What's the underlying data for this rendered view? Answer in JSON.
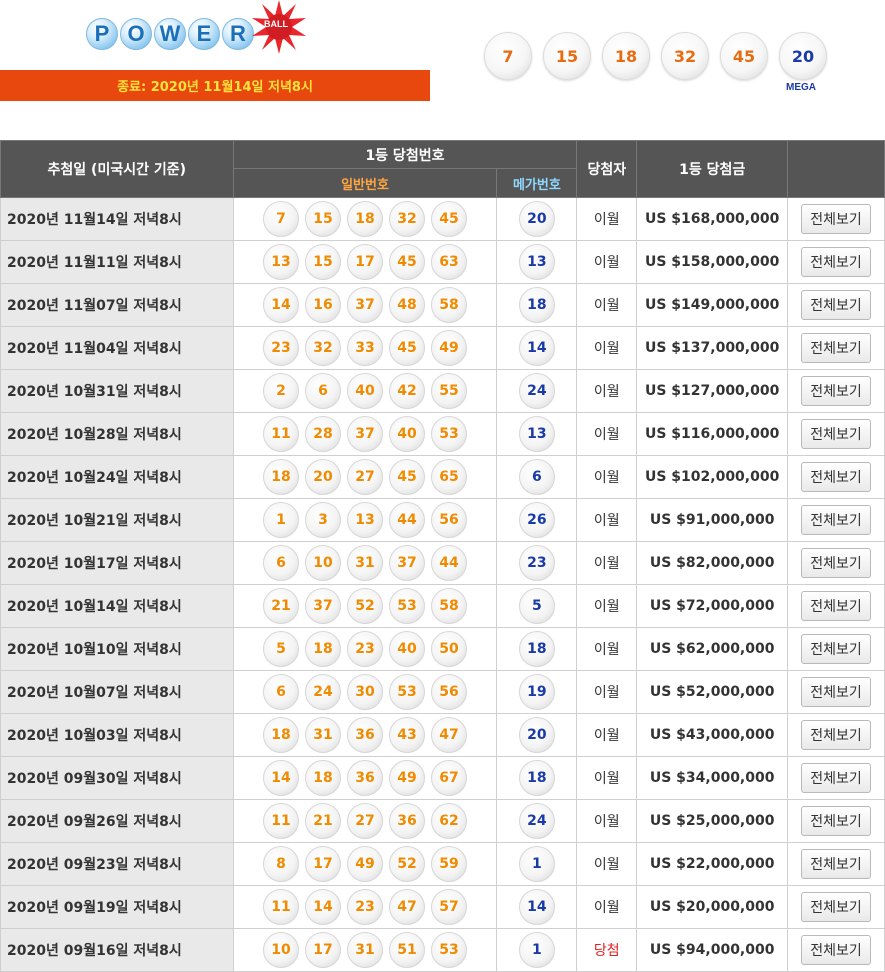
{
  "logo": {
    "letters": [
      "P",
      "O",
      "W",
      "E",
      "R"
    ],
    "ball_text": "BALL"
  },
  "closing": "종료: 2020년 11월14일 저녁8시",
  "latest": {
    "normal": [
      "7",
      "15",
      "18",
      "32",
      "45"
    ],
    "mega": "20",
    "mega_tag": "MEGA"
  },
  "headers": {
    "date": "추첨일 (미국시간 기준)",
    "first_numbers": "1등 당첨번호",
    "normal": "일반번호",
    "mega": "메가번호",
    "winner": "당첨자",
    "prize": "1등 당첨금"
  },
  "rows": [
    {
      "date": "2020년 11월14일 저녁8시",
      "n": [
        "7",
        "15",
        "18",
        "32",
        "45"
      ],
      "mega": "20",
      "winner": "이월",
      "prize": "US $168,000,000",
      "button": "전체보기"
    },
    {
      "date": "2020년 11월11일 저녁8시",
      "n": [
        "13",
        "15",
        "17",
        "45",
        "63"
      ],
      "mega": "13",
      "winner": "이월",
      "prize": "US $158,000,000",
      "button": "전체보기"
    },
    {
      "date": "2020년 11월07일 저녁8시",
      "n": [
        "14",
        "16",
        "37",
        "48",
        "58"
      ],
      "mega": "18",
      "winner": "이월",
      "prize": "US $149,000,000",
      "button": "전체보기"
    },
    {
      "date": "2020년 11월04일 저녁8시",
      "n": [
        "23",
        "32",
        "33",
        "45",
        "49"
      ],
      "mega": "14",
      "winner": "이월",
      "prize": "US $137,000,000",
      "button": "전체보기"
    },
    {
      "date": "2020년 10월31일 저녁8시",
      "n": [
        "2",
        "6",
        "40",
        "42",
        "55"
      ],
      "mega": "24",
      "winner": "이월",
      "prize": "US $127,000,000",
      "button": "전체보기"
    },
    {
      "date": "2020년 10월28일 저녁8시",
      "n": [
        "11",
        "28",
        "37",
        "40",
        "53"
      ],
      "mega": "13",
      "winner": "이월",
      "prize": "US $116,000,000",
      "button": "전체보기"
    },
    {
      "date": "2020년 10월24일 저녁8시",
      "n": [
        "18",
        "20",
        "27",
        "45",
        "65"
      ],
      "mega": "6",
      "winner": "이월",
      "prize": "US $102,000,000",
      "button": "전체보기"
    },
    {
      "date": "2020년 10월21일 저녁8시",
      "n": [
        "1",
        "3",
        "13",
        "44",
        "56"
      ],
      "mega": "26",
      "winner": "이월",
      "prize": "US $91,000,000",
      "button": "전체보기"
    },
    {
      "date": "2020년 10월17일 저녁8시",
      "n": [
        "6",
        "10",
        "31",
        "37",
        "44"
      ],
      "mega": "23",
      "winner": "이월",
      "prize": "US $82,000,000",
      "button": "전체보기"
    },
    {
      "date": "2020년 10월14일 저녁8시",
      "n": [
        "21",
        "37",
        "52",
        "53",
        "58"
      ],
      "mega": "5",
      "winner": "이월",
      "prize": "US $72,000,000",
      "button": "전체보기"
    },
    {
      "date": "2020년 10월10일 저녁8시",
      "n": [
        "5",
        "18",
        "23",
        "40",
        "50"
      ],
      "mega": "18",
      "winner": "이월",
      "prize": "US $62,000,000",
      "button": "전체보기"
    },
    {
      "date": "2020년 10월07일 저녁8시",
      "n": [
        "6",
        "24",
        "30",
        "53",
        "56"
      ],
      "mega": "19",
      "winner": "이월",
      "prize": "US $52,000,000",
      "button": "전체보기"
    },
    {
      "date": "2020년 10월03일 저녁8시",
      "n": [
        "18",
        "31",
        "36",
        "43",
        "47"
      ],
      "mega": "20",
      "winner": "이월",
      "prize": "US $43,000,000",
      "button": "전체보기"
    },
    {
      "date": "2020년 09월30일 저녁8시",
      "n": [
        "14",
        "18",
        "36",
        "49",
        "67"
      ],
      "mega": "18",
      "winner": "이월",
      "prize": "US $34,000,000",
      "button": "전체보기"
    },
    {
      "date": "2020년 09월26일 저녁8시",
      "n": [
        "11",
        "21",
        "27",
        "36",
        "62"
      ],
      "mega": "24",
      "winner": "이월",
      "prize": "US $25,000,000",
      "button": "전체보기"
    },
    {
      "date": "2020년 09월23일 저녁8시",
      "n": [
        "8",
        "17",
        "49",
        "52",
        "59"
      ],
      "mega": "1",
      "winner": "이월",
      "prize": "US $22,000,000",
      "button": "전체보기"
    },
    {
      "date": "2020년 09월19일 저녁8시",
      "n": [
        "11",
        "14",
        "23",
        "47",
        "57"
      ],
      "mega": "14",
      "winner": "이월",
      "prize": "US $20,000,000",
      "button": "전체보기"
    },
    {
      "date": "2020년 09월16일 저녁8시",
      "n": [
        "10",
        "17",
        "31",
        "51",
        "53"
      ],
      "mega": "1",
      "winner": "당첨",
      "prize": "US $94,000,000",
      "button": "전체보기"
    }
  ],
  "colors": {
    "closing_bar": "#e8470e",
    "normal_ball": "#f08a00",
    "mega_ball": "#1a3aa8",
    "header": "#555555",
    "win": "#e02020"
  }
}
